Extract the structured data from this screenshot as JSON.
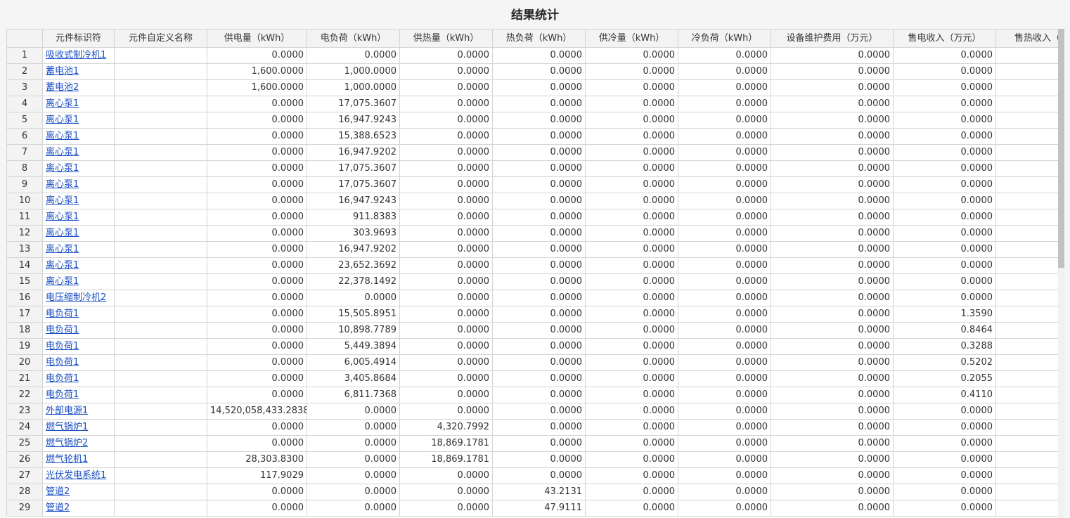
{
  "title": "结果统计",
  "columns": [
    "",
    "元件标识符",
    "元件自定义名称",
    "供电量（kWh）",
    "电负荷（kWh）",
    "供热量（kWh）",
    "热负荷（kWh）",
    "供冷量（kWh）",
    "冷负荷（kWh）",
    "设备维护费用（万元）",
    "售电收入（万元）",
    "售热收入（"
  ],
  "rows": [
    {
      "n": "1",
      "id": "吸收式制冷机1",
      "name": "",
      "c": [
        "0.0000",
        "0.0000",
        "0.0000",
        "0.0000",
        "0.0000",
        "0.0000",
        "0.0000",
        "0.0000",
        ""
      ]
    },
    {
      "n": "2",
      "id": "蓄电池1",
      "name": "",
      "c": [
        "1,600.0000",
        "1,000.0000",
        "0.0000",
        "0.0000",
        "0.0000",
        "0.0000",
        "0.0000",
        "0.0000",
        ""
      ]
    },
    {
      "n": "3",
      "id": "蓄电池2",
      "name": "",
      "c": [
        "1,600.0000",
        "1,000.0000",
        "0.0000",
        "0.0000",
        "0.0000",
        "0.0000",
        "0.0000",
        "0.0000",
        ""
      ]
    },
    {
      "n": "4",
      "id": "离心泵1",
      "name": "",
      "c": [
        "0.0000",
        "17,075.3607",
        "0.0000",
        "0.0000",
        "0.0000",
        "0.0000",
        "0.0000",
        "0.0000",
        ""
      ]
    },
    {
      "n": "5",
      "id": "离心泵1",
      "name": "",
      "c": [
        "0.0000",
        "16,947.9243",
        "0.0000",
        "0.0000",
        "0.0000",
        "0.0000",
        "0.0000",
        "0.0000",
        ""
      ]
    },
    {
      "n": "6",
      "id": "离心泵1",
      "name": "",
      "c": [
        "0.0000",
        "15,388.6523",
        "0.0000",
        "0.0000",
        "0.0000",
        "0.0000",
        "0.0000",
        "0.0000",
        ""
      ]
    },
    {
      "n": "7",
      "id": "离心泵1",
      "name": "",
      "c": [
        "0.0000",
        "16,947.9202",
        "0.0000",
        "0.0000",
        "0.0000",
        "0.0000",
        "0.0000",
        "0.0000",
        ""
      ]
    },
    {
      "n": "8",
      "id": "离心泵1",
      "name": "",
      "c": [
        "0.0000",
        "17,075.3607",
        "0.0000",
        "0.0000",
        "0.0000",
        "0.0000",
        "0.0000",
        "0.0000",
        ""
      ]
    },
    {
      "n": "9",
      "id": "离心泵1",
      "name": "",
      "c": [
        "0.0000",
        "17,075.3607",
        "0.0000",
        "0.0000",
        "0.0000",
        "0.0000",
        "0.0000",
        "0.0000",
        ""
      ]
    },
    {
      "n": "10",
      "id": "离心泵1",
      "name": "",
      "c": [
        "0.0000",
        "16,947.9243",
        "0.0000",
        "0.0000",
        "0.0000",
        "0.0000",
        "0.0000",
        "0.0000",
        ""
      ]
    },
    {
      "n": "11",
      "id": "离心泵1",
      "name": "",
      "c": [
        "0.0000",
        "911.8383",
        "0.0000",
        "0.0000",
        "0.0000",
        "0.0000",
        "0.0000",
        "0.0000",
        ""
      ]
    },
    {
      "n": "12",
      "id": "离心泵1",
      "name": "",
      "c": [
        "0.0000",
        "303.9693",
        "0.0000",
        "0.0000",
        "0.0000",
        "0.0000",
        "0.0000",
        "0.0000",
        ""
      ]
    },
    {
      "n": "13",
      "id": "离心泵1",
      "name": "",
      "c": [
        "0.0000",
        "16,947.9202",
        "0.0000",
        "0.0000",
        "0.0000",
        "0.0000",
        "0.0000",
        "0.0000",
        ""
      ]
    },
    {
      "n": "14",
      "id": "离心泵1",
      "name": "",
      "c": [
        "0.0000",
        "23,652.3692",
        "0.0000",
        "0.0000",
        "0.0000",
        "0.0000",
        "0.0000",
        "0.0000",
        ""
      ]
    },
    {
      "n": "15",
      "id": "离心泵1",
      "name": "",
      "c": [
        "0.0000",
        "22,378.1492",
        "0.0000",
        "0.0000",
        "0.0000",
        "0.0000",
        "0.0000",
        "0.0000",
        ""
      ]
    },
    {
      "n": "16",
      "id": "电压缩制冷机2",
      "name": "",
      "c": [
        "0.0000",
        "0.0000",
        "0.0000",
        "0.0000",
        "0.0000",
        "0.0000",
        "0.0000",
        "0.0000",
        ""
      ]
    },
    {
      "n": "17",
      "id": "电负荷1",
      "name": "",
      "c": [
        "0.0000",
        "15,505.8951",
        "0.0000",
        "0.0000",
        "0.0000",
        "0.0000",
        "0.0000",
        "1.3590",
        ""
      ]
    },
    {
      "n": "18",
      "id": "电负荷1",
      "name": "",
      "c": [
        "0.0000",
        "10,898.7789",
        "0.0000",
        "0.0000",
        "0.0000",
        "0.0000",
        "0.0000",
        "0.8464",
        ""
      ]
    },
    {
      "n": "19",
      "id": "电负荷1",
      "name": "",
      "c": [
        "0.0000",
        "5,449.3894",
        "0.0000",
        "0.0000",
        "0.0000",
        "0.0000",
        "0.0000",
        "0.3288",
        ""
      ]
    },
    {
      "n": "20",
      "id": "电负荷1",
      "name": "",
      "c": [
        "0.0000",
        "6,005.4914",
        "0.0000",
        "0.0000",
        "0.0000",
        "0.0000",
        "0.0000",
        "0.5202",
        ""
      ]
    },
    {
      "n": "21",
      "id": "电负荷1",
      "name": "",
      "c": [
        "0.0000",
        "3,405.8684",
        "0.0000",
        "0.0000",
        "0.0000",
        "0.0000",
        "0.0000",
        "0.2055",
        ""
      ]
    },
    {
      "n": "22",
      "id": "电负荷1",
      "name": "",
      "c": [
        "0.0000",
        "6,811.7368",
        "0.0000",
        "0.0000",
        "0.0000",
        "0.0000",
        "0.0000",
        "0.4110",
        ""
      ]
    },
    {
      "n": "23",
      "id": "外部电源1",
      "name": "",
      "c": [
        "14,520,058,433.2838",
        "0.0000",
        "0.0000",
        "0.0000",
        "0.0000",
        "0.0000",
        "0.0000",
        "0.0000",
        ""
      ]
    },
    {
      "n": "24",
      "id": "燃气锅炉1",
      "name": "",
      "c": [
        "0.0000",
        "0.0000",
        "4,320.7992",
        "0.0000",
        "0.0000",
        "0.0000",
        "0.0000",
        "0.0000",
        ""
      ]
    },
    {
      "n": "25",
      "id": "燃气锅炉2",
      "name": "",
      "c": [
        "0.0000",
        "0.0000",
        "18,869.1781",
        "0.0000",
        "0.0000",
        "0.0000",
        "0.0000",
        "0.0000",
        ""
      ]
    },
    {
      "n": "26",
      "id": "燃气轮机1",
      "name": "",
      "c": [
        "28,303.8300",
        "0.0000",
        "18,869.1781",
        "0.0000",
        "0.0000",
        "0.0000",
        "0.0000",
        "0.0000",
        ""
      ]
    },
    {
      "n": "27",
      "id": "光伏发电系统1",
      "name": "",
      "c": [
        "117.9029",
        "0.0000",
        "0.0000",
        "0.0000",
        "0.0000",
        "0.0000",
        "0.0000",
        "0.0000",
        ""
      ]
    },
    {
      "n": "28",
      "id": "管道2",
      "name": "",
      "c": [
        "0.0000",
        "0.0000",
        "0.0000",
        "43.2131",
        "0.0000",
        "0.0000",
        "0.0000",
        "0.0000",
        ""
      ]
    },
    {
      "n": "29",
      "id": "管道2",
      "name": "",
      "c": [
        "0.0000",
        "0.0000",
        "0.0000",
        "47.9111",
        "0.0000",
        "0.0000",
        "0.0000",
        "0.0000",
        ""
      ]
    }
  ]
}
